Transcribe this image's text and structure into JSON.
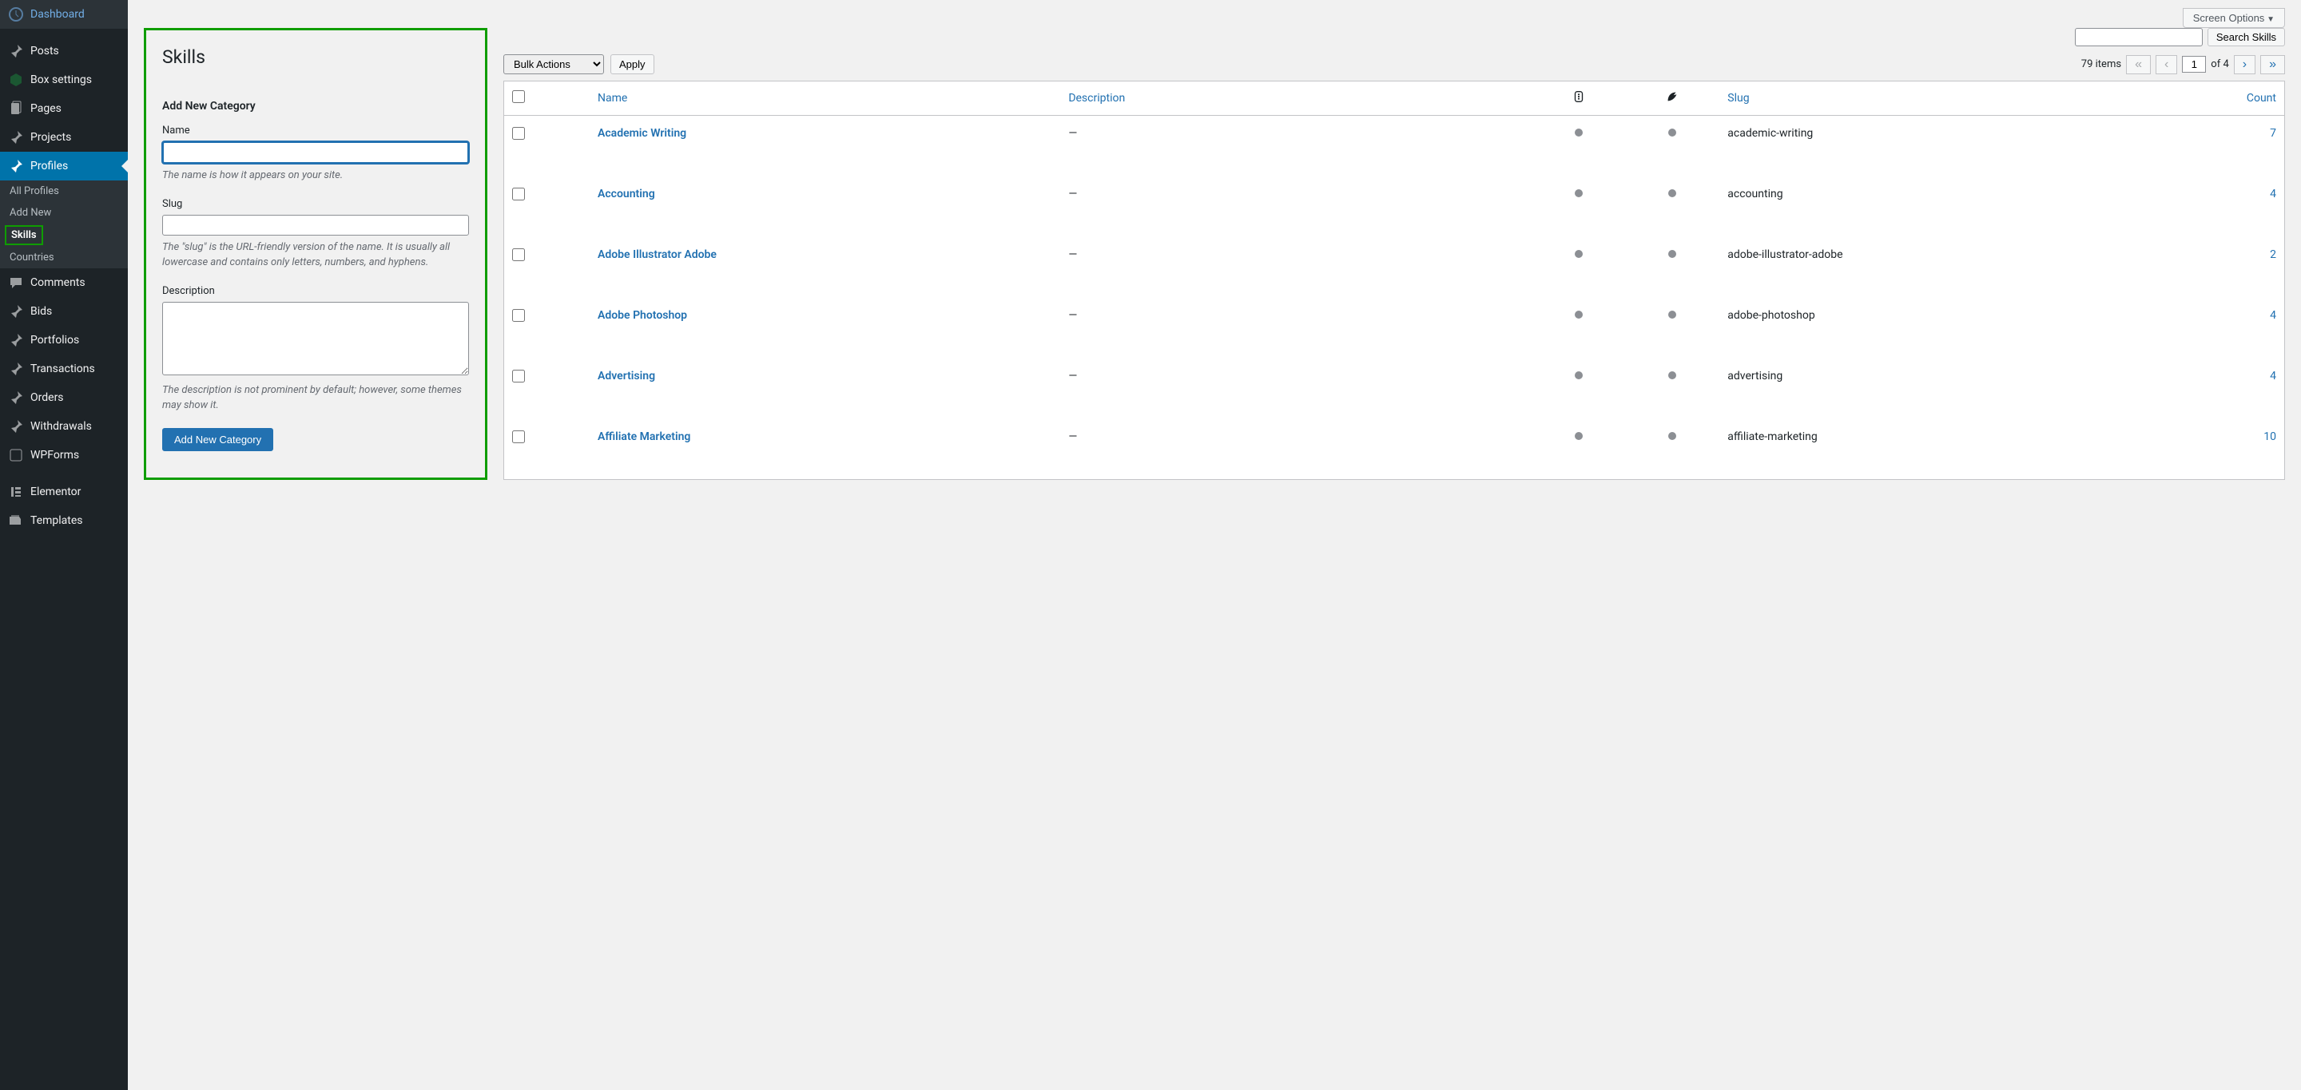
{
  "screen_options": "Screen Options",
  "sidebar": {
    "items": [
      {
        "label": "Dashboard",
        "icon": "dashboard"
      },
      {
        "label": "Posts",
        "icon": "pin"
      },
      {
        "label": "Box settings",
        "icon": "box"
      },
      {
        "label": "Pages",
        "icon": "page"
      },
      {
        "label": "Projects",
        "icon": "pin"
      },
      {
        "label": "Profiles",
        "icon": "pin",
        "active": true
      },
      {
        "label": "Comments",
        "icon": "comment"
      },
      {
        "label": "Bids",
        "icon": "pin"
      },
      {
        "label": "Portfolios",
        "icon": "pin"
      },
      {
        "label": "Transactions",
        "icon": "pin"
      },
      {
        "label": "Orders",
        "icon": "pin"
      },
      {
        "label": "Withdrawals",
        "icon": "pin"
      },
      {
        "label": "WPForms",
        "icon": "forms"
      },
      {
        "label": "Elementor",
        "icon": "elementor"
      },
      {
        "label": "Templates",
        "icon": "templates"
      }
    ],
    "sub": [
      {
        "label": "All Profiles"
      },
      {
        "label": "Add New"
      },
      {
        "label": "Skills",
        "current": true
      },
      {
        "label": "Countries"
      }
    ]
  },
  "page": {
    "title": "Skills",
    "form_title": "Add New Category",
    "name_label": "Name",
    "name_help": "The name is how it appears on your site.",
    "slug_label": "Slug",
    "slug_help": "The \"slug\" is the URL-friendly version of the name. It is usually all lowercase and contains only letters, numbers, and hyphens.",
    "desc_label": "Description",
    "desc_help": "The description is not prominent by default; however, some themes may show it.",
    "submit_label": "Add New Category"
  },
  "table": {
    "search_button": "Search Skills",
    "bulk_label": "Bulk Actions",
    "apply_label": "Apply",
    "items_count": "79 items",
    "page_of": "of 4",
    "current_page": "1",
    "headers": {
      "name": "Name",
      "description": "Description",
      "slug": "Slug",
      "count": "Count"
    },
    "rows": [
      {
        "name": "Academic Writing",
        "description": "—",
        "slug": "academic-writing",
        "count": "7"
      },
      {
        "name": "Accounting",
        "description": "—",
        "slug": "accounting",
        "count": "4"
      },
      {
        "name": "Adobe Illustrator Adobe",
        "description": "—",
        "slug": "adobe-illustrator-adobe",
        "count": "2"
      },
      {
        "name": "Adobe Photoshop",
        "description": "—",
        "slug": "adobe-photoshop",
        "count": "4"
      },
      {
        "name": "Advertising",
        "description": "—",
        "slug": "advertising",
        "count": "4"
      },
      {
        "name": "Affiliate Marketing",
        "description": "—",
        "slug": "affiliate-marketing",
        "count": "10"
      }
    ]
  }
}
